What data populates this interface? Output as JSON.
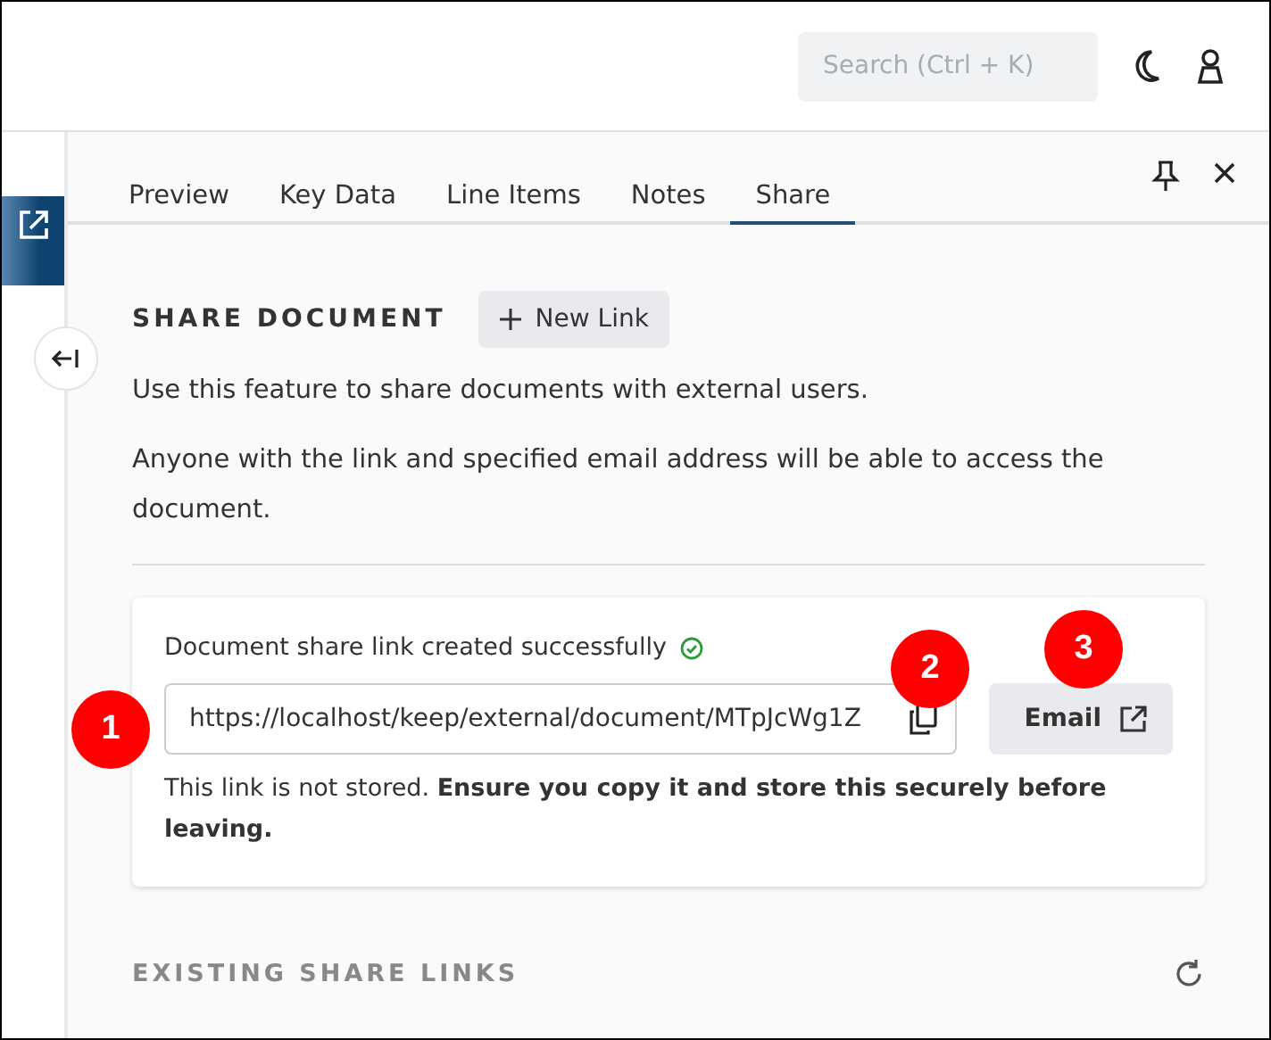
{
  "header": {
    "search": {
      "placeholder": "Search (Ctrl + K)"
    }
  },
  "tabs": [
    {
      "label": "Preview",
      "selected": false
    },
    {
      "label": "Key Data",
      "selected": false
    },
    {
      "label": "Line Items",
      "selected": false
    },
    {
      "label": "Notes",
      "selected": false
    },
    {
      "label": "Share",
      "selected": true
    }
  ],
  "share": {
    "heading": "SHARE DOCUMENT",
    "new_link_button": "New Link",
    "paragraphs": [
      "Use this feature to share documents with external users.",
      "Anyone with the link and specified email address will be able to access the document."
    ],
    "card": {
      "status": "Document share link created successfully",
      "link": "https://localhost/keep/external/document/MTpJcWg1Z",
      "email_button": "Email",
      "note": "This link is not stored. **Ensure you copy it and store this securely before leaving.**"
    },
    "existing_heading": "EXISTING SHARE LINKS"
  },
  "annotations": [
    "1",
    "2",
    "3"
  ]
}
